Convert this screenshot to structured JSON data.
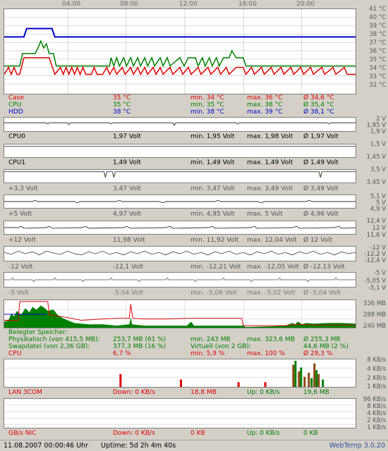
{
  "time_axis": [
    "04:00",
    "08:00",
    "12:00",
    "16:00",
    "20:00"
  ],
  "temperature": {
    "axis": [
      "41 °C",
      "40 °C",
      "39 °C",
      "38 °C",
      "37 °C",
      "36 °C",
      "35 °C",
      "34 °C",
      "33 °C",
      "32 °C"
    ],
    "rows": [
      {
        "label": "Case",
        "current": "35 °C",
        "min": "min. 34 °C",
        "max": "max. 36 °C",
        "avg": "Ø 34,6 °C"
      },
      {
        "label": "CPU",
        "current": "35 °C",
        "min": "min. 35 °C",
        "max": "max. 38 °C",
        "avg": "Ø 35,4 °C"
      },
      {
        "label": "HDD",
        "current": "38 °C",
        "min": "min. 38 °C",
        "max": "max. 39 °C",
        "avg": "Ø 38,1 °C"
      }
    ],
    "colors": {
      "case": "#e00000",
      "cpu": "#008000",
      "hdd": "#0000c8"
    }
  },
  "voltages": [
    {
      "label": "CPU0",
      "current": "1,97 Volt",
      "min": "min. 1,95 Volt",
      "max": "max. 1,98 Volt",
      "avg": "Ø 1,97 Volt",
      "axis": [
        "2 V",
        "1,95 V",
        "1,9 V"
      ],
      "label_color": "#000"
    },
    {
      "label": "CPU1",
      "current": "1,49 Volt",
      "min": "min. 1,49 Volt",
      "max": "max. 1,49 Volt",
      "avg": "Ø 1,49 Volt",
      "axis": [
        "1,5 V",
        "",
        "1,45 V"
      ],
      "label_color": "#000"
    },
    {
      "label": "+3,3 Volt",
      "current": "3,47 Volt",
      "min": "min. 3,47 Volt",
      "max": "max. 3,49 Volt",
      "avg": "Ø 3,49 Volt",
      "axis": [
        "3,5 V",
        "",
        "3,45 V"
      ],
      "label_color": "#555"
    },
    {
      "label": "+5 Volt",
      "current": "4,97 Volt",
      "min": "min. 4,95 Volt",
      "max": "max. 5 Volt",
      "avg": "Ø 4,96 Volt",
      "axis": [
        "5,1 V",
        "5 V",
        "4,9 V"
      ],
      "label_color": "#555"
    },
    {
      "label": "+12 Volt",
      "current": "11,98 Volt",
      "min": "min. 11,92 Volt",
      "max": "max. 12,04 Volt",
      "avg": "Ø 12 Volt",
      "axis": [
        "12,4 V",
        "12 V",
        "11,6 V"
      ],
      "label_color": "#555"
    },
    {
      "label": "-12 Volt",
      "current": "-12,1 Volt",
      "min": "min. -12,21 Volt",
      "max": "max. -12,05 Volt",
      "avg": "Ø -12,13 Volt",
      "axis": [
        "-12 V",
        "-12,2 V",
        "-12,4 V"
      ],
      "label_color": "#555"
    },
    {
      "label": "-5 Volt",
      "current": "-5,04 Volt",
      "min": "min. -5,06 Volt",
      "max": "max. -5,02 Volt",
      "avg": "Ø -5,04 Volt",
      "axis": [
        "-5 V",
        "-5,05 V",
        "-5,1 V"
      ],
      "label_color": "#555"
    }
  ],
  "memory": {
    "axis": [
      "336 MB",
      "288 MB",
      "240 MB"
    ],
    "heading": "Belegter Speicher:",
    "rows": [
      {
        "label": "Physikalisch (von 415,5 MB):",
        "current": "253,7 MB (61 %)",
        "min": "min. 243 MB",
        "max": "max. 323,6 MB",
        "avg": "Ø 255,3 MB"
      },
      {
        "label": "Swapdatei (von 2,36 GB):",
        "current": "377,3 MB (16 %)",
        "min": "Virtuell (von 2 GB):",
        "max": "",
        "avg": "44,6 MB (2 %)"
      }
    ],
    "cpu": {
      "label": "CPU",
      "current": "6,7 %",
      "min": "min. 5,9 %",
      "max": "max. 100 %",
      "avg": "Ø 29,3 %"
    }
  },
  "lan": {
    "axis": [
      "8 KB/s",
      "4 KB/s",
      "2 KB/s",
      "1 KB/s"
    ],
    "label": "LAN 3COM",
    "down": "Down: 0 KB/s",
    "down_total": "18,8 MB",
    "up": "Up: 0 KB/s",
    "up_total": "19,6 MB"
  },
  "nic": {
    "axis": [
      "96 KB/s",
      "8 KB/s",
      "4 KB/s",
      "2 KB/s",
      "1 KB/s"
    ],
    "label": "GB/s NIC",
    "down": "Down: 0 KB/s",
    "down_total": "0 KB",
    "up": "Up: 0 KB/s",
    "up_total": "0 KB"
  },
  "footer": {
    "datetime": "11.08.2007 00:00:46 Uhr",
    "uptime": "Uptime: 5d 2h 4m 40s",
    "app": "WebTemp 3.0.20"
  }
}
